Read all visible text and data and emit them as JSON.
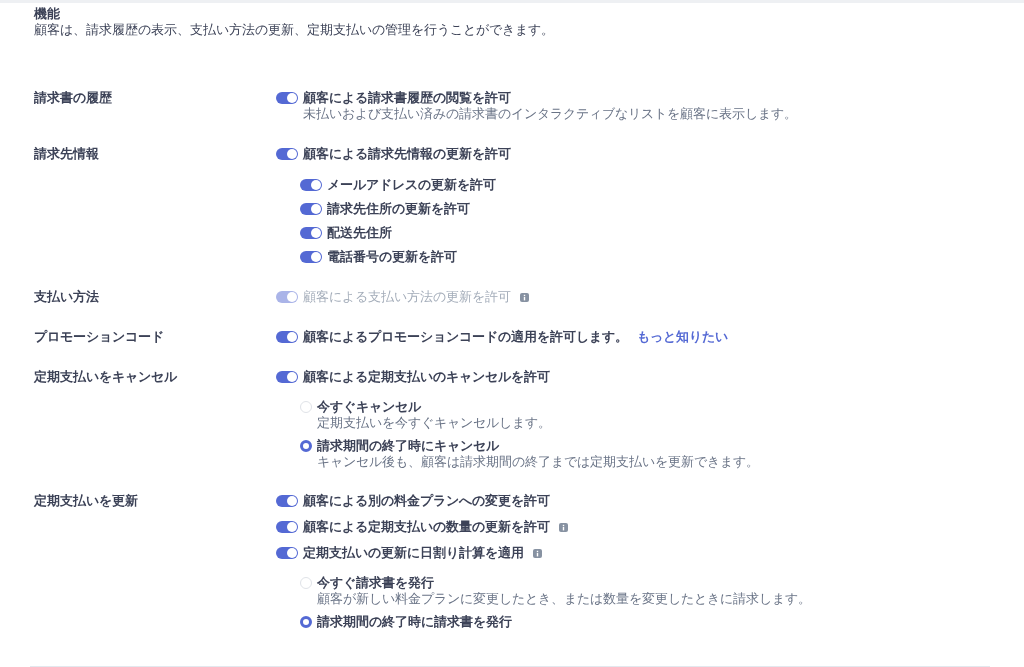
{
  "header": {
    "title": "機能",
    "description": "顧客は、請求履歴の表示、支払い方法の更新、定期支払いの管理を行うことができます。"
  },
  "sections": [
    {
      "label": "請求書の履歴",
      "items": [
        {
          "kind": "toggle",
          "label": "顧客による請求書履歴の閲覧を許可",
          "on": true,
          "disabled": false,
          "info": false,
          "description": "未払いおよび支払い済みの請求書のインタラクティブなリストを顧客に表示します。"
        }
      ]
    },
    {
      "label": "請求先情報",
      "items": [
        {
          "kind": "toggle",
          "label": "顧客による請求先情報の更新を許可",
          "on": true,
          "disabled": false,
          "info": false,
          "children": [
            {
              "label": "メールアドレスの更新を許可",
              "on": true
            },
            {
              "label": "請求先住所の更新を許可",
              "on": true
            },
            {
              "label": "配送先住所",
              "on": true
            },
            {
              "label": "電話番号の更新を許可",
              "on": true
            }
          ]
        }
      ]
    },
    {
      "label": "支払い方法",
      "items": [
        {
          "kind": "toggle",
          "label": "顧客による支払い方法の更新を許可",
          "on": true,
          "disabled": true,
          "info": true
        }
      ]
    },
    {
      "label": "プロモーションコード",
      "items": [
        {
          "kind": "toggle",
          "label": "顧客によるプロモーションコードの適用を許可します。",
          "link": "もっと知りたい",
          "on": true,
          "disabled": false,
          "info": false
        }
      ]
    },
    {
      "label": "定期支払いをキャンセル",
      "items": [
        {
          "kind": "toggle",
          "label": "顧客による定期支払いのキャンセルを許可",
          "on": true,
          "disabled": false,
          "info": false
        },
        {
          "kind": "radio",
          "label": "今すぐキャンセル",
          "description": "定期支払いを今すぐキャンセルします。",
          "selected": false
        },
        {
          "kind": "radio",
          "label": "請求期間の終了時にキャンセル",
          "description": "キャンセル後も、顧客は請求期間の終了までは定期支払いを更新できます。",
          "selected": true
        }
      ]
    },
    {
      "label": "定期支払いを更新",
      "items": [
        {
          "kind": "toggle",
          "label": "顧客による別の料金プランへの変更を許可",
          "on": true,
          "disabled": false,
          "info": false
        },
        {
          "kind": "toggle",
          "label": "顧客による定期支払いの数量の更新を許可",
          "on": true,
          "disabled": false,
          "info": true
        },
        {
          "kind": "toggle",
          "label": "定期支払いの更新に日割り計算を適用",
          "on": true,
          "disabled": false,
          "info": true
        },
        {
          "kind": "radio",
          "label": "今すぐ請求書を発行",
          "description": "顧客が新しい料金プランに変更したとき、または数量を変更したときに請求します。",
          "selected": false
        },
        {
          "kind": "radio",
          "label": "請求期間の終了時に請求書を発行",
          "selected": true
        }
      ]
    }
  ]
}
